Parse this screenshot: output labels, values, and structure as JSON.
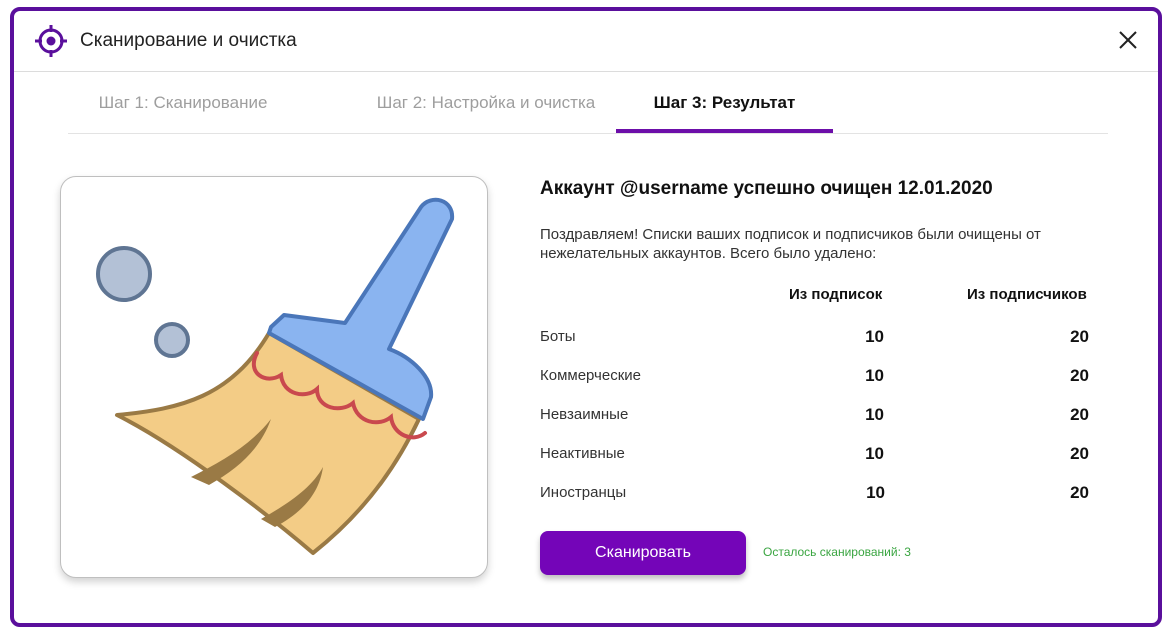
{
  "window": {
    "title": "Сканирование и очистка"
  },
  "tabs": [
    {
      "label": "Шаг 1: Сканирование",
      "active": false
    },
    {
      "label": "Шаг 2: Настройка и очистка",
      "active": false
    },
    {
      "label": "Шаг 3: Результат",
      "active": true
    }
  ],
  "result": {
    "title": "Аккаунт @username успешно очищен 12.01.2020",
    "description": "Поздравляем! Списки ваших подписок и подписчиков были очищены от нежелательных аккаунтов. Всего было удалено:",
    "columns": [
      "Из подписок",
      "Из подписчиков"
    ],
    "rows": [
      {
        "label": "Боты",
        "subscriptions": "10",
        "subscribers": "20"
      },
      {
        "label": "Коммерческие",
        "subscriptions": "10",
        "subscribers": "20"
      },
      {
        "label": "Невзаимные",
        "subscriptions": "10",
        "subscribers": "20"
      },
      {
        "label": "Неактивные",
        "subscriptions": "10",
        "subscribers": "20"
      },
      {
        "label": "Иностранцы",
        "subscriptions": "10",
        "subscribers": "20"
      }
    ]
  },
  "actions": {
    "scan_label": "Сканировать",
    "remaining_text": "Осталось сканирований: 3"
  },
  "icons": {
    "logo": "target-icon",
    "close": "close-icon",
    "illustration": "broom-icon"
  },
  "colors": {
    "accent": "#6c0ea9",
    "button": "#7405b8",
    "success": "#3aa541"
  }
}
